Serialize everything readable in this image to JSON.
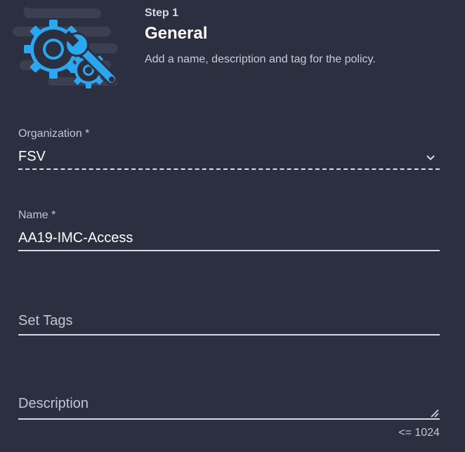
{
  "header": {
    "step": "Step 1",
    "title": "General",
    "subtitle": "Add a name, description and tag for the policy."
  },
  "icons": {
    "hero": "gear-wrench-icon",
    "dropdown": "chevron-down-icon",
    "resize": "resize-handle-icon"
  },
  "colors": {
    "background": "#2b2f40",
    "accent": "#2aa7f0",
    "gear_outline": "#1f2233"
  },
  "form": {
    "organization": {
      "label": "Organization *",
      "value": "FSV"
    },
    "name": {
      "label": "Name *",
      "value": "AA19-IMC-Access"
    },
    "tags": {
      "placeholder": "Set Tags"
    },
    "description": {
      "placeholder": "Description",
      "limit_text": "<= 1024"
    }
  }
}
